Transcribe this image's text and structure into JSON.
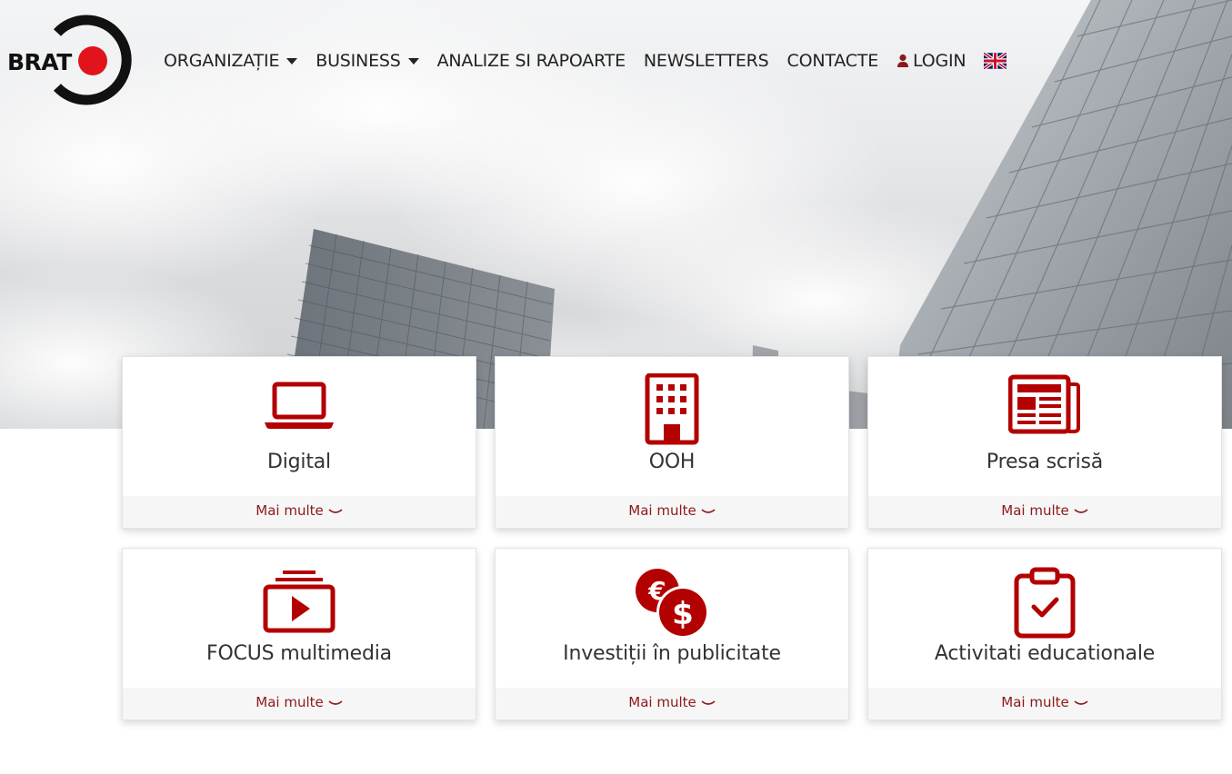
{
  "brand": {
    "logo_text": "BRAT",
    "accent_color": "#b30000",
    "red_dot_color": "#e0141a"
  },
  "nav": {
    "items": [
      {
        "label": "ORGANIZAȚIE",
        "has_dropdown": true
      },
      {
        "label": "BUSINESS",
        "has_dropdown": true
      },
      {
        "label": "ANALIZE SI RAPOARTE",
        "has_dropdown": false
      },
      {
        "label": "NEWSLETTERS",
        "has_dropdown": false
      },
      {
        "label": "CONTACTE",
        "has_dropdown": false
      }
    ],
    "login_label": "LOGIN",
    "language_flag": "uk-flag-icon"
  },
  "cards": [
    {
      "title": "Digital",
      "link": "Mai multe",
      "icon": "laptop-icon"
    },
    {
      "title": "OOH",
      "link": "Mai multe",
      "icon": "building-icon"
    },
    {
      "title": "Presa scrisă",
      "link": "Mai multe",
      "icon": "newspaper-icon"
    },
    {
      "title": "FOCUS multimedia",
      "link": "Mai multe",
      "icon": "video-playlist-icon"
    },
    {
      "title": "Investiții în publicitate",
      "link": "Mai multe",
      "icon": "euro-dollar-coins-icon"
    },
    {
      "title": "Activitati educationale",
      "link": "Mai multe",
      "icon": "clipboard-check-icon"
    }
  ]
}
